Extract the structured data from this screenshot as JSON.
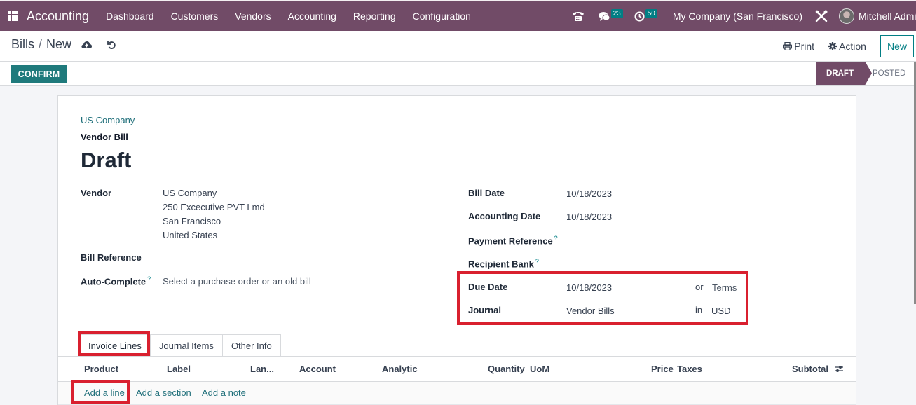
{
  "navbar": {
    "app_name": "Accounting",
    "menu": [
      "Dashboard",
      "Customers",
      "Vendors",
      "Accounting",
      "Reporting",
      "Configuration"
    ],
    "icons": {
      "apps": "apps-grid-icon",
      "phone": "phone-icon",
      "messages": "chat-icon",
      "activities": "clock-icon",
      "debug": "tools-icon"
    },
    "messages_count": "23",
    "activities_count": "50",
    "company": "My Company (San Francisco)",
    "user": "Mitchell Admin"
  },
  "control_panel": {
    "breadcrumb_parent": "Bills",
    "breadcrumb_separator": "/",
    "breadcrumb_current": "New",
    "print_label": "Print",
    "action_label": "Action",
    "new_label": "New"
  },
  "statusbar": {
    "confirm_label": "CONFIRM",
    "stages": [
      {
        "label": "DRAFT",
        "active": true
      },
      {
        "label": "POSTED",
        "active": false
      }
    ]
  },
  "form": {
    "company": "US Company",
    "doc_type": "Vendor Bill",
    "title": "Draft",
    "left_fields": {
      "vendor_label": "Vendor",
      "vendor_lines": [
        "US Company",
        "250 Excecutive PVT Lmd",
        "San Francisco",
        "United States"
      ],
      "bill_reference_label": "Bill Reference",
      "bill_reference_value": "",
      "auto_complete_label": "Auto-Complete",
      "auto_complete_help": "?",
      "auto_complete_placeholder": "Select a purchase order or an old bill"
    },
    "right_fields": {
      "bill_date_label": "Bill Date",
      "bill_date_value": "10/18/2023",
      "accounting_date_label": "Accounting Date",
      "accounting_date_value": "10/18/2023",
      "payment_reference_label": "Payment Reference",
      "payment_reference_help": "?",
      "recipient_bank_label": "Recipient Bank",
      "recipient_bank_help": "?",
      "due_date_label": "Due Date",
      "due_date_value": "10/18/2023",
      "due_or": "or",
      "terms_placeholder": "Terms",
      "journal_label": "Journal",
      "journal_value": "Vendor Bills",
      "journal_in": "in",
      "currency_value": "USD"
    },
    "tabs": [
      {
        "label": "Invoice Lines",
        "active": true
      },
      {
        "label": "Journal Items",
        "active": false
      },
      {
        "label": "Other Info",
        "active": false
      }
    ],
    "columns": [
      "Product",
      "Label",
      "Lan...",
      "Account",
      "Analytic",
      "Quantity",
      "UoM",
      "Price",
      "Taxes",
      "Subtotal"
    ],
    "add_links": [
      "Add a line",
      "Add a section",
      "Add a note"
    ]
  },
  "colors": {
    "brand": "#714b67",
    "primary": "#017e84",
    "confirm": "#1f7a7c",
    "highlight": "#d9202f"
  }
}
